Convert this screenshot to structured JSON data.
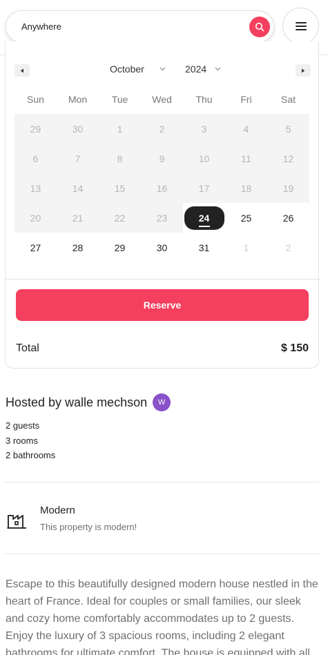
{
  "search": {
    "value": "Anywhere"
  },
  "calendar": {
    "month": "October",
    "year": "2024",
    "weekdays": [
      "Sun",
      "Mon",
      "Tue",
      "Wed",
      "Thu",
      "Fri",
      "Sat"
    ],
    "weeks": [
      [
        "29",
        "30",
        "1",
        "2",
        "3",
        "4",
        "5"
      ],
      [
        "6",
        "7",
        "8",
        "9",
        "10",
        "11",
        "12"
      ],
      [
        "13",
        "14",
        "15",
        "16",
        "17",
        "18",
        "19"
      ],
      [
        "20",
        "21",
        "22",
        "23",
        "24",
        "25",
        "26"
      ],
      [
        "27",
        "28",
        "29",
        "30",
        "31",
        "1",
        "2"
      ]
    ]
  },
  "reserve_label": "Reserve",
  "total": {
    "label": "Total",
    "value": "$ 150"
  },
  "host": {
    "title": "Hosted by walle mechson",
    "initial": "W"
  },
  "facts": [
    "2 guests",
    "3 rooms",
    "2 bathrooms"
  ],
  "feature": {
    "title": "Modern",
    "description": "This property is modern!",
    "icon": "building-icon"
  },
  "description": "Escape to this beautifully designed modern house nestled in the heart of France. Ideal for couples or small families, our sleek and cozy home comfortably accommodates up to 2 guests. Enjoy the luxury of 3 spacious rooms, including 2 elegant bathrooms for ultimate comfort. The house is equipped with all",
  "colors": {
    "accent": "#f43f5e",
    "avatar": "#8a52c9",
    "selected": "#222222"
  }
}
